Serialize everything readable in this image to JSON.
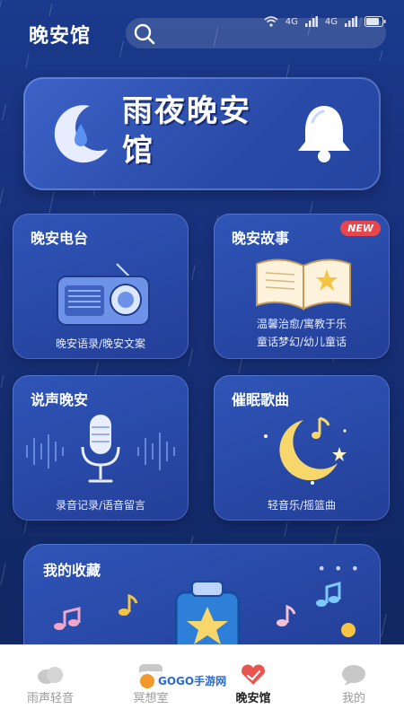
{
  "header": {
    "title": "晚安馆",
    "search_icon": "search-icon"
  },
  "status_bar": {
    "wifi": "wifi-icon",
    "signal_1": "4G",
    "signal_2": "4G",
    "battery": "battery-icon"
  },
  "banner": {
    "title": "雨夜晚安馆",
    "moon_icon": "moon-drop-icon",
    "bell_icon": "bell-icon"
  },
  "cards": [
    {
      "title": "晚安电台",
      "subtitle": "晚安语录/晚安文案",
      "icon": "radio-icon"
    },
    {
      "title": "晚安故事",
      "subtitle_line1": "温馨治愈/寓教于乐",
      "subtitle_line2": "童话梦幻/幼儿童话",
      "badge": "NEW",
      "icon": "book-icon"
    },
    {
      "title": "说声晚安",
      "subtitle": "录音记录/语音留言",
      "icon": "microphone-icon"
    },
    {
      "title": "催眠歌曲",
      "subtitle": "轻音乐/摇篮曲",
      "icon": "moon-music-icon"
    }
  ],
  "favorites": {
    "title": "我的收藏",
    "more": "• • •"
  },
  "tabbar": {
    "tabs": [
      {
        "label": "雨声轻音",
        "icon": "rain-cloud-icon"
      },
      {
        "label": "冥想室",
        "icon": "play-icon"
      },
      {
        "label": "晚安馆",
        "icon": "heart-icon",
        "active": true
      },
      {
        "label": "我的",
        "icon": "chat-icon"
      }
    ]
  },
  "watermark": {
    "text": "GOGO手游网"
  },
  "colors": {
    "background": "#17307a",
    "card": "#2a4ba8",
    "badge": "#e5474c",
    "accent_heart": "#e8554e"
  }
}
